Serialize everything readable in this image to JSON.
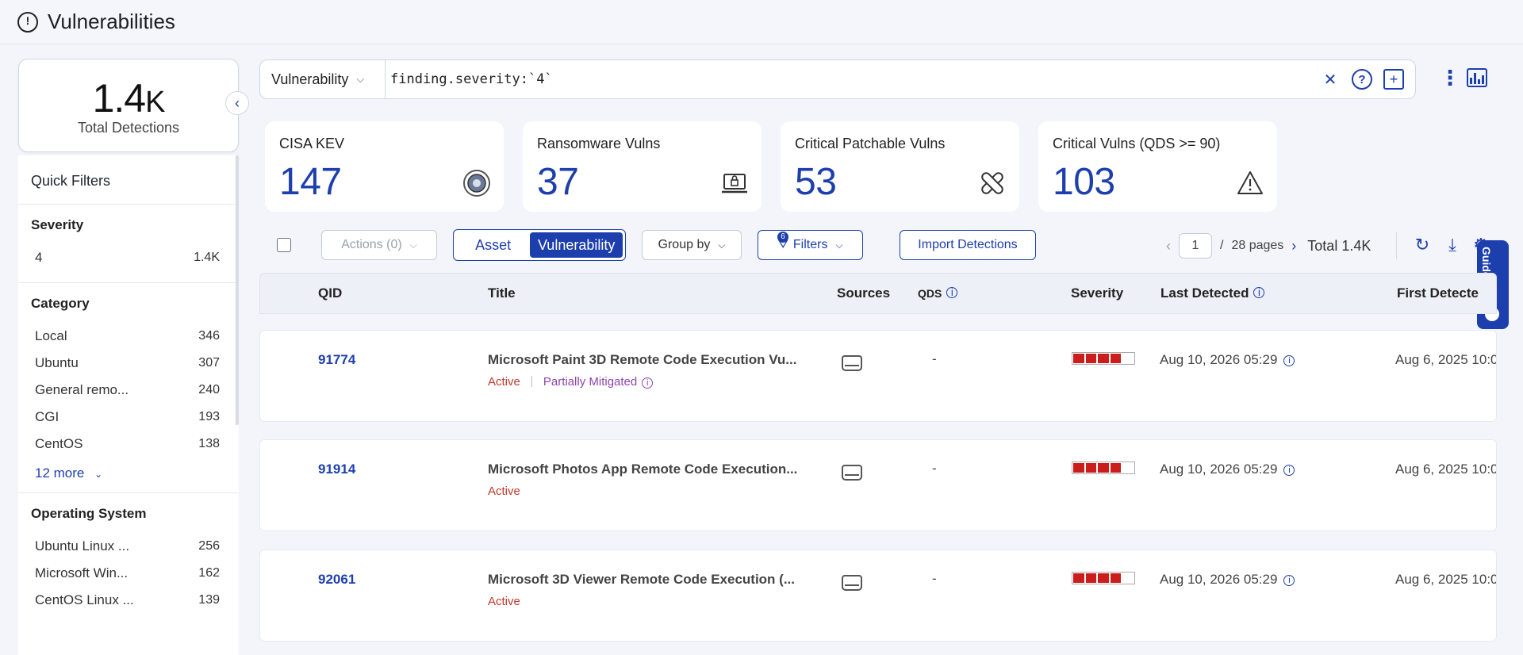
{
  "header": {
    "title": "Vulnerabilities",
    "logo_icon": "alert-clock-icon"
  },
  "summary": {
    "count": "1.4",
    "count_suffix": "K",
    "label": "Total Detections"
  },
  "quick_filters": {
    "title": "Quick Filters",
    "severity": {
      "title": "Severity",
      "items": [
        {
          "label": "4",
          "count": "1.4K"
        }
      ]
    },
    "category": {
      "title": "Category",
      "items": [
        {
          "label": "Local",
          "count": "346"
        },
        {
          "label": "Ubuntu",
          "count": "307"
        },
        {
          "label": "General remo...",
          "count": "240"
        },
        {
          "label": "CGI",
          "count": "193"
        },
        {
          "label": "CentOS",
          "count": "138"
        }
      ],
      "more": "12 more"
    },
    "os": {
      "title": "Operating System",
      "items": [
        {
          "label": "Ubuntu Linux ...",
          "count": "256"
        },
        {
          "label": "Microsoft Win...",
          "count": "162"
        },
        {
          "label": "CentOS Linux ...",
          "count": "139"
        }
      ]
    }
  },
  "search": {
    "scope": "Vulnerability",
    "query": "finding.severity:`4`"
  },
  "stats": [
    {
      "title": "CISA KEV",
      "value": "147",
      "icon": "cisa-seal-icon"
    },
    {
      "title": "Ransomware Vulns",
      "value": "37",
      "icon": "ransomware-laptop-icon"
    },
    {
      "title": "Critical Patchable Vulns",
      "value": "53",
      "icon": "patch-bandage-icon"
    },
    {
      "title": "Critical Vulns (QDS >= 90)",
      "value": "103",
      "icon": "warning-triangle-icon"
    }
  ],
  "toolbar": {
    "actions": "Actions (0)",
    "view_asset": "Asset",
    "view_vulnerability": "Vulnerability",
    "group_by": "Group by",
    "filters": "Filters",
    "filters_count": "6",
    "import": "Import Detections"
  },
  "pager": {
    "page": "1",
    "pages": "28 pages",
    "total": "Total 1.4K"
  },
  "guide": {
    "label": "Guide Me"
  },
  "table": {
    "columns": {
      "qid": "QID",
      "title": "Title",
      "sources": "Sources",
      "qds": "QDS",
      "severity": "Severity",
      "last_detected": "Last Detected",
      "first_detected": "First Detecte"
    },
    "rows": [
      {
        "qid": "91774",
        "title": "Microsoft Paint 3D Remote Code Execution Vu...",
        "status": "Active",
        "status2": "Partially Mitigated",
        "qds": "-",
        "severity": 4,
        "last": "Aug 10, 2026 05:29",
        "first": "Aug 6, 2025 10:0"
      },
      {
        "qid": "91914",
        "title": "Microsoft Photos App Remote Code Execution...",
        "status": "Active",
        "status2": "",
        "qds": "-",
        "severity": 4,
        "last": "Aug 10, 2026 05:29",
        "first": "Aug 6, 2025 10:0"
      },
      {
        "qid": "92061",
        "title": "Microsoft 3D Viewer Remote Code Execution (...",
        "status": "Active",
        "status2": "",
        "qds": "-",
        "severity": 4,
        "last": "Aug 10, 2026 05:29",
        "first": "Aug 6, 2025 10:0"
      }
    ]
  },
  "colors": {
    "accent": "#1d3fae",
    "severity_red": "#cc1d1d",
    "active_red": "#c0392b",
    "mitigated_purple": "#8e44ad"
  }
}
